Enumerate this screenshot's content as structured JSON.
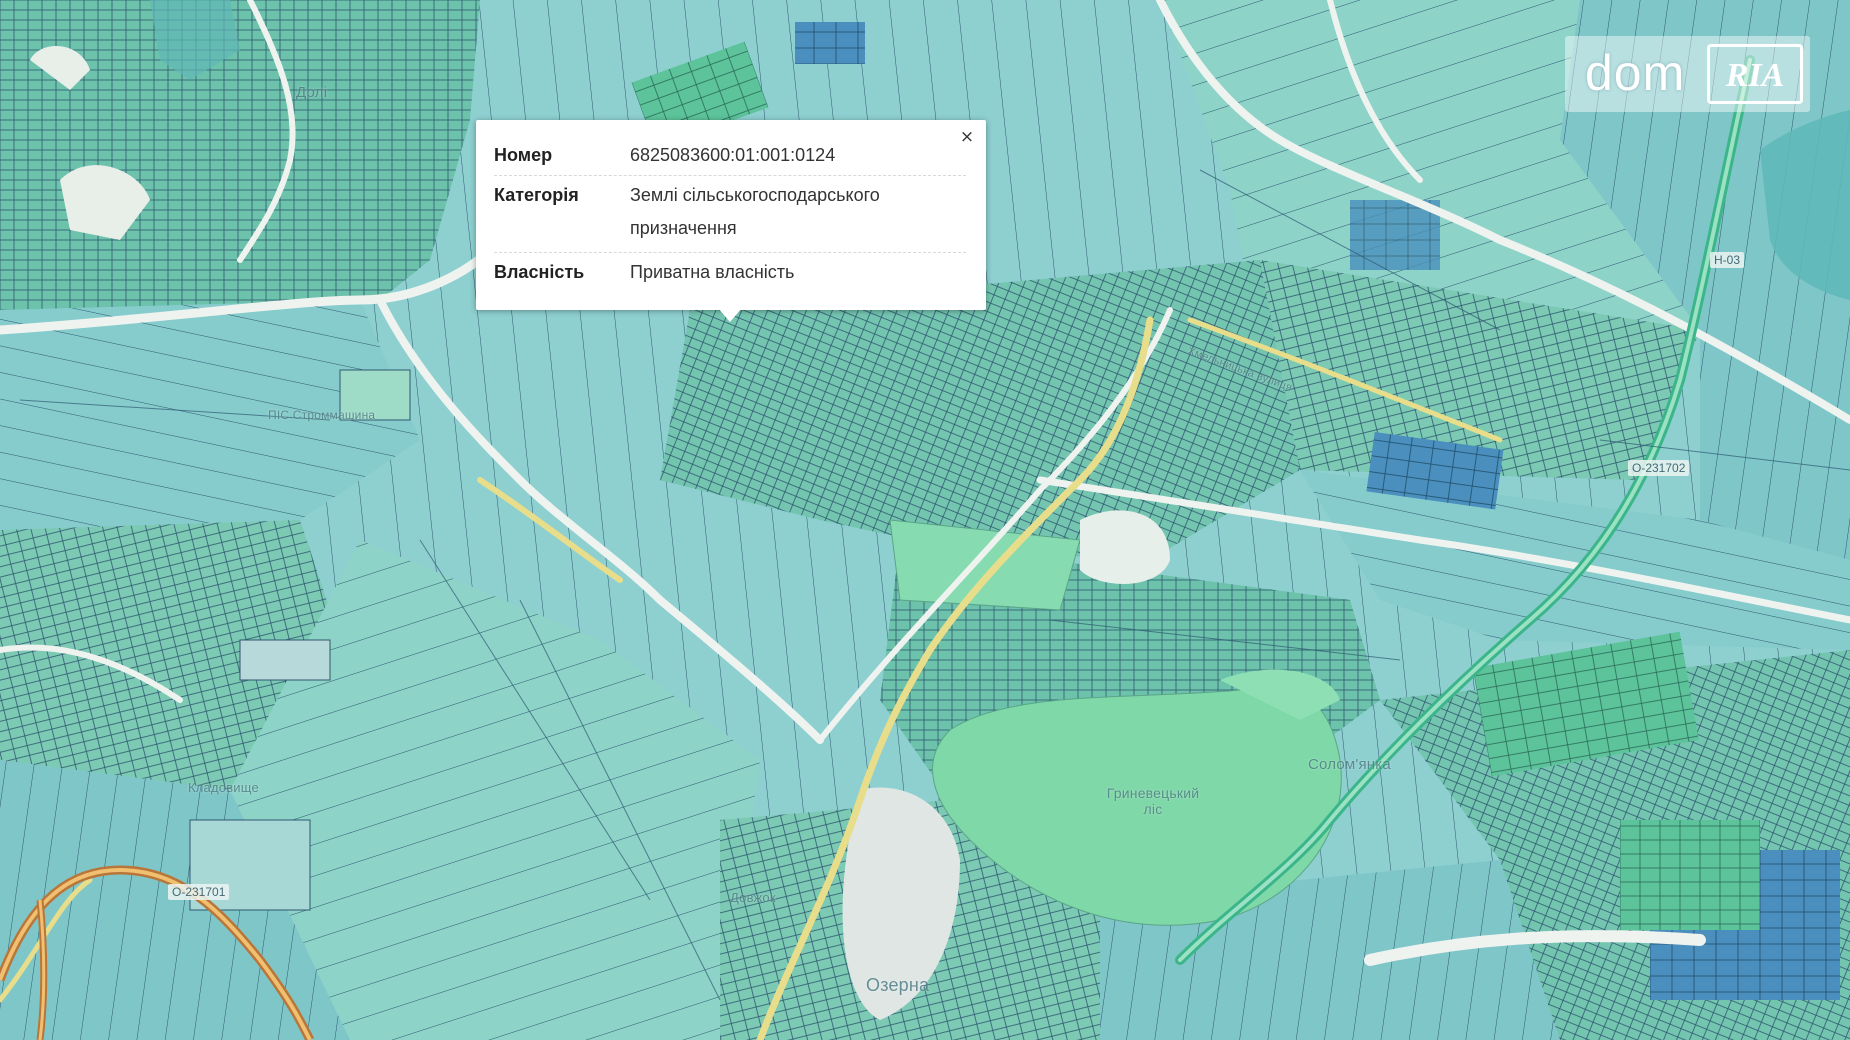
{
  "popup": {
    "close_label": "×",
    "rows": [
      {
        "key": "Номер",
        "value": "6825083600:01:001:0124"
      },
      {
        "key": "Категорія",
        "value": "Землі сільськогосподарського призначення"
      },
      {
        "key": "Власність",
        "value": "Приватна власність"
      }
    ]
  },
  "logo": {
    "dom_text": "dom",
    "ria_text": "RIA"
  },
  "map": {
    "labels": {
      "village_top": "Долі",
      "enterprise": "ПІС Строммашина",
      "cemetery": "Кладовище",
      "forest": "Гриневецький ліс",
      "east_area": "Солом'янка",
      "settlement_south": "Озерна",
      "settlement_sw": "Довжок",
      "street": "Хмельницька вулиця"
    },
    "road_codes": {
      "sw": "О-231701",
      "east": "О-231702",
      "ne": "Н-03"
    },
    "colors": {
      "parcel_blue": "#8ecfd0",
      "parcel_teal": "#6cc2ab",
      "parcel_green": "#9adfc4",
      "parcel_dark": "#3d7fb0",
      "parcel_line": "#2e5870",
      "forest": "#7fd8a8",
      "road_yellow": "#e8dd8a",
      "road_white": "#eef3ef"
    }
  }
}
